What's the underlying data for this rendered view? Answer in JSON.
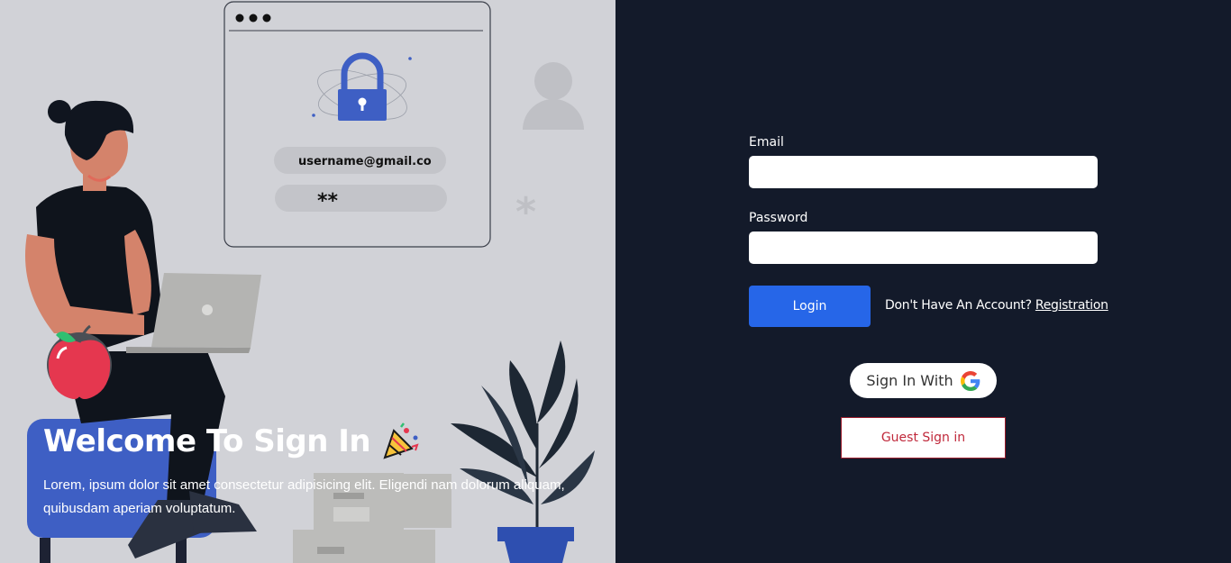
{
  "illustration": {
    "username_text": "username@gmail.co",
    "password_text": "**"
  },
  "hero": {
    "title": "Welcome To Sign In",
    "description": "Lorem, ipsum dolor sit amet consectetur adipisicing elit. Eligendi nam dolorum aliquam, quibusdam aperiam voluptatum."
  },
  "form": {
    "email_label": "Email",
    "email_value": "",
    "password_label": "Password",
    "password_value": "",
    "login_label": "Login",
    "no_account_text": "Don't Have An Account?",
    "registration_link": "Registration",
    "google_label": "Sign In With",
    "guest_label": "Guest Sign in"
  },
  "colors": {
    "left_bg": "#d1d2d7",
    "right_bg": "#131a2a",
    "accent": "#2666e8",
    "guest_border": "#9b1c2c"
  }
}
